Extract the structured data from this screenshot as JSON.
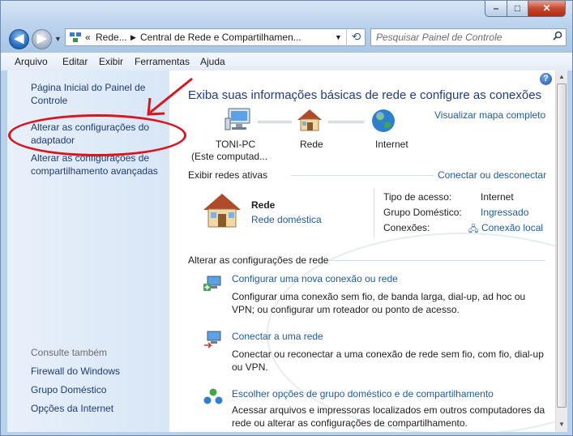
{
  "navigation": {
    "breadcrumb": [
      "Rede...",
      "Central de Rede e Compartilhamen..."
    ],
    "search_placeholder": "Pesquisar Painel de Controle"
  },
  "menu": [
    "Arquivo",
    "Editar",
    "Exibir",
    "Ferramentas",
    "Ajuda"
  ],
  "sidebar": {
    "links": [
      {
        "line1": "Página Inicial do Painel de",
        "line2": "Controle"
      },
      {
        "line1": "Alterar as configurações do",
        "line2": "adaptador"
      },
      {
        "line1": "Alterar as configurações de",
        "line2": "compartilhamento avançadas"
      }
    ],
    "see_also_title": "Consulte também",
    "see_also": [
      "Firewall do Windows",
      "Grupo Doméstico",
      "Opções da Internet"
    ]
  },
  "main": {
    "title": "Exiba suas informações básicas de rede e configure as conexões",
    "view_full_map": "Visualizar mapa completo",
    "map": {
      "computer_line1": "TONI-PC",
      "computer_line2": "(Este computad...",
      "network": "Rede",
      "internet": "Internet"
    },
    "active_networks_label": "Exibir redes ativas",
    "connect_disconnect": "Conectar ou desconectar",
    "network": {
      "name": "Rede",
      "type_link": "Rede doméstica",
      "access_type_label": "Tipo de acesso:",
      "access_type_value": "Internet",
      "homegroup_label": "Grupo Doméstico:",
      "homegroup_value": "Ingressado",
      "connections_label": "Conexões:",
      "connections_value": "Conexão local"
    },
    "change_settings_label": "Alterar as configurações de rede",
    "tasks": [
      {
        "title": "Configurar uma nova conexão ou rede",
        "desc1": "Configurar uma conexão sem fio, de banda larga, dial-up, ad hoc ou",
        "desc2": "VPN; ou configurar um roteador ou ponto de acesso."
      },
      {
        "title": "Conectar a uma rede",
        "desc1": "Conectar ou reconectar a uma conexão de rede sem fio, com fio, dial-up",
        "desc2": "ou VPN."
      },
      {
        "title": "Escolher opções de grupo doméstico e de compartilhamento",
        "desc1": "Acessar arquivos e impressoras localizados em outros computadores da",
        "desc2": "rede ou alterar as configurações de compartilhamento."
      }
    ]
  },
  "annotation_color": "#d8161d"
}
